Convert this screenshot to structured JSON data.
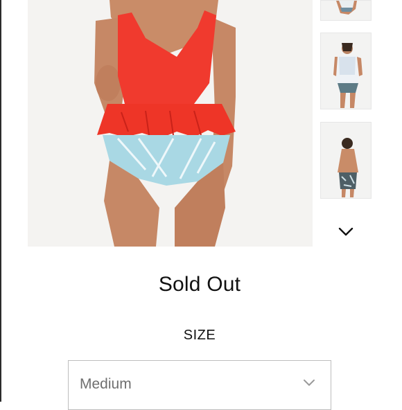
{
  "product": {
    "status_text": "Sold Out",
    "size_label": "SIZE",
    "size_select": {
      "selected": "Medium"
    }
  },
  "gallery": {
    "thumbnails": [
      "swimsuit-front-thumb",
      "swimsuit-white-thumb",
      "swimsuit-back-thumb"
    ],
    "next_icon": "chevron-down-icon"
  },
  "colors": {
    "top_red": "#f03a2e",
    "bottom_pattern": "#a9d8e4",
    "skin": "#c98c68",
    "hair": "#2a1e19",
    "border": "#bdbdbd"
  }
}
